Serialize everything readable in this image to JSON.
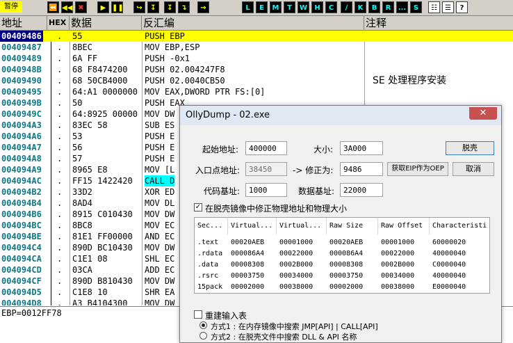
{
  "toolbar": {
    "status": "暂停",
    "buttons": [
      "⏪",
      "◀◀",
      "✖",
      "▶",
      "❚❚",
      "↪",
      "↧",
      "↧",
      "↴",
      "→"
    ],
    "letters": [
      "L",
      "E",
      "M",
      "T",
      "W",
      "H",
      "C",
      "/",
      "K",
      "B",
      "R",
      "...",
      "S"
    ]
  },
  "columns": {
    "addr": "地址",
    "hex_tag": "HEX",
    "hex": "数据",
    "dis": "反汇编",
    "cmt": "注释"
  },
  "rows": [
    {
      "addr": "00409486",
      "hex": "55",
      "dis": "PUSH EBP",
      "cmt": ""
    },
    {
      "addr": "00409487",
      "hex": "8BEC",
      "dis": "MOV EBP,ESP",
      "cmt": ""
    },
    {
      "addr": "00409489",
      "hex": "6A FF",
      "dis": "PUSH -0x1",
      "cmt": ""
    },
    {
      "addr": "0040948B",
      "hex": "68 F8474200",
      "dis": "PUSH 02.004247F8",
      "cmt": ""
    },
    {
      "addr": "00409490",
      "hex": "68 50CB4000",
      "dis": "PUSH 02.0040CB50",
      "cmt": ""
    },
    {
      "addr": "00409495",
      "hex": "64:A1 0000000",
      "dis": "MOV EAX,DWORD PTR FS:[0]",
      "cmt": ""
    },
    {
      "addr": "0040949B",
      "hex": "50",
      "dis": "PUSH EAX",
      "cmt": ""
    },
    {
      "addr": "0040949C",
      "hex": "64:8925 00000",
      "dis": "MOV DW",
      "cmt": ""
    },
    {
      "addr": "004094A3",
      "hex": "83EC 58",
      "dis": "SUB ES",
      "cmt": ""
    },
    {
      "addr": "004094A6",
      "hex": "53",
      "dis": "PUSH E",
      "cmt": ""
    },
    {
      "addr": "004094A7",
      "hex": "56",
      "dis": "PUSH E",
      "cmt": ""
    },
    {
      "addr": "004094A8",
      "hex": "57",
      "dis": "PUSH E",
      "cmt": ""
    },
    {
      "addr": "004094A9",
      "hex": "8965 E8",
      "dis": "MOV [L",
      "cmt": ""
    },
    {
      "addr": "004094AC",
      "hex": "FF15 1422420",
      "dis": "CALL D",
      "cmt": ""
    },
    {
      "addr": "004094B2",
      "hex": "33D2",
      "dis": "XOR ED",
      "cmt": ""
    },
    {
      "addr": "004094B4",
      "hex": "8AD4",
      "dis": "MOV DL",
      "cmt": ""
    },
    {
      "addr": "004094B6",
      "hex": "8915 C010430",
      "dis": "MOV DW",
      "cmt": ""
    },
    {
      "addr": "004094BC",
      "hex": "8BC8",
      "dis": "MOV EC",
      "cmt": ""
    },
    {
      "addr": "004094BE",
      "hex": "81E1 FF00000",
      "dis": "AND EC",
      "cmt": ""
    },
    {
      "addr": "004094C4",
      "hex": "890D BC10430",
      "dis": "MOV DW",
      "cmt": ""
    },
    {
      "addr": "004094CA",
      "hex": "C1E1 08",
      "dis": "SHL EC",
      "cmt": ""
    },
    {
      "addr": "004094CD",
      "hex": "03CA",
      "dis": "ADD EC",
      "cmt": ""
    },
    {
      "addr": "004094CF",
      "hex": "890D B810430",
      "dis": "MOV DW",
      "cmt": ""
    },
    {
      "addr": "004094D5",
      "hex": "C1E8 10",
      "dis": "SHR EA",
      "cmt": ""
    },
    {
      "addr": "004094D8",
      "hex": "A3 B4104300",
      "dis": "MOV DW",
      "cmt": ""
    }
  ],
  "comment_se": "SE 处理程序安装",
  "register_line": "EBP=0012FF78",
  "dialog": {
    "title": "OllyDump - 02.exe",
    "close": "✕",
    "start_addr_label": "起始地址:",
    "start_addr": "400000",
    "size_label": "大小:",
    "size": "3A000",
    "dump_btn": "脱壳",
    "entry_label": "入口点地址:",
    "entry": "38450",
    "correct_label": "-> 修正为:",
    "correct": "9486",
    "get_eip_btn": "获取EIP作为OEP",
    "cancel_btn": "取消",
    "code_base_label": "代码基址:",
    "code_base": "1000",
    "data_base_label": "数据基址:",
    "data_base": "22000",
    "fix_check_label": "在脱壳镜像中修正物理地址和物理大小",
    "sections_headers": [
      "Sec...",
      "Virtual...",
      "Virtual...",
      "Raw Size",
      "Raw Offset",
      "Characteristi"
    ],
    "sections": [
      [
        ".text",
        "00020AEB",
        "00001000",
        "00020AEB",
        "00001000",
        "60000020"
      ],
      [
        ".rdata",
        "000086A4",
        "00022000",
        "000086A4",
        "00022000",
        "40000040"
      ],
      [
        ".data",
        "00008308",
        "0002B000",
        "00008308",
        "0002B000",
        "C0000040"
      ],
      [
        ".rsrc",
        "00003750",
        "00034000",
        "00003750",
        "00034000",
        "40000040"
      ],
      [
        "15pack",
        "00002000",
        "00038000",
        "00002000",
        "00038000",
        "E0000040"
      ]
    ],
    "rebuild_label": "重建输入表",
    "method1": "方式1 : 在内存镜像中搜索 JMP[API] | CALL[API]",
    "method2": "方式2 : 在脱壳文件中搜索 DLL & API 名称"
  }
}
